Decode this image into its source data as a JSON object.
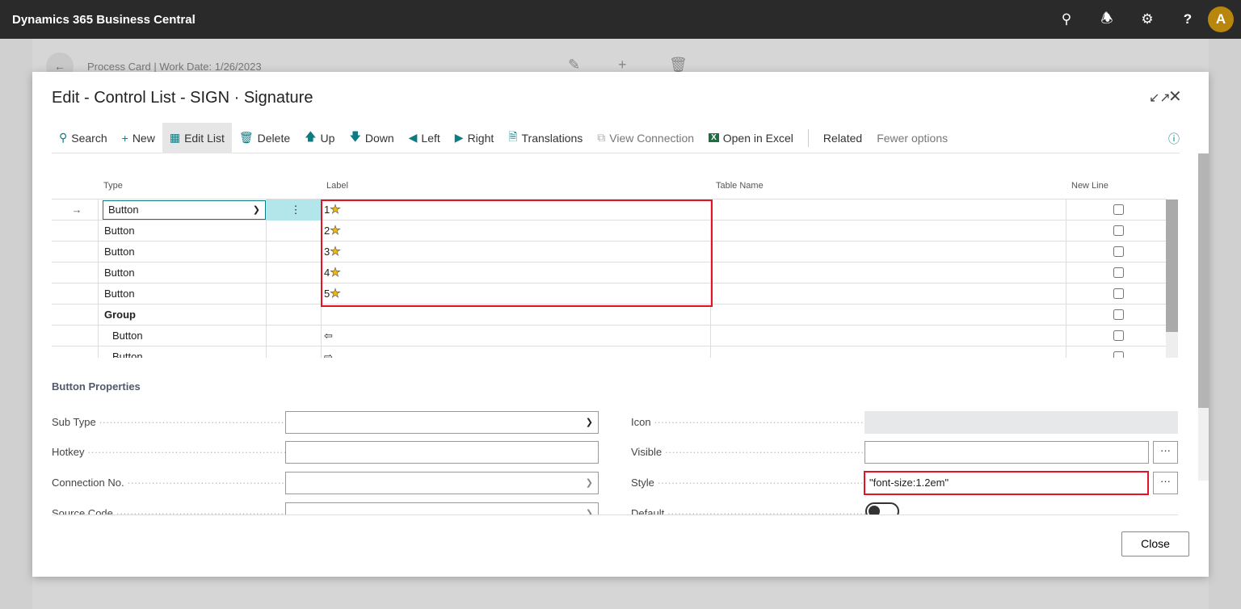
{
  "app": {
    "title": "Dynamics 365 Business Central",
    "avatar": "A",
    "icons": [
      "search-icon",
      "bell-icon",
      "gear-icon",
      "help-icon"
    ]
  },
  "background_page": {
    "header": "Process Card | Work Date: 1/26/2023"
  },
  "dialog": {
    "title": "Edit - Control List - SIGN · Signature",
    "toolbar": [
      {
        "icon": "search-icon",
        "label": "Search"
      },
      {
        "icon": "plus-icon",
        "label": "New"
      },
      {
        "icon": "edit-list-icon",
        "label": "Edit List",
        "active": true
      },
      {
        "icon": "delete-icon",
        "label": "Delete"
      },
      {
        "icon": "arrow-up-icon",
        "label": "Up"
      },
      {
        "icon": "arrow-down-icon",
        "label": "Down"
      },
      {
        "icon": "triangle-left-icon",
        "label": "Left"
      },
      {
        "icon": "triangle-right-icon",
        "label": "Right"
      },
      {
        "icon": "translations-icon",
        "label": "Translations"
      },
      {
        "icon": "view-connection-icon",
        "label": "View Connection",
        "disabled": true
      },
      {
        "icon": "excel-icon",
        "label": "Open in Excel"
      },
      {
        "label": "Related"
      },
      {
        "label": "Fewer options",
        "muted": true
      }
    ],
    "grid": {
      "columns": [
        "Type",
        "Label",
        "Table Name",
        "New Line"
      ],
      "rows": [
        {
          "type": "Button",
          "label": "1",
          "star": true,
          "selected": true
        },
        {
          "type": "Button",
          "label": "2",
          "star": true
        },
        {
          "type": "Button",
          "label": "3",
          "star": true
        },
        {
          "type": "Button",
          "label": "4",
          "star": true
        },
        {
          "type": "Button",
          "label": "5",
          "star": true
        },
        {
          "type": "Group",
          "label": "",
          "bold": true
        },
        {
          "type": "Button",
          "label": "⇦",
          "indent": true
        },
        {
          "type": "Button",
          "label": "⇨",
          "indent": true
        }
      ]
    },
    "properties": {
      "heading": "Button Properties",
      "left": [
        {
          "label": "Sub Type",
          "value": "",
          "kind": "select"
        },
        {
          "label": "Hotkey",
          "value": ""
        },
        {
          "label": "Connection No.",
          "value": "",
          "kind": "lookup"
        },
        {
          "label": "Source Code",
          "value": "",
          "kind": "lookup"
        }
      ],
      "right": [
        {
          "label": "Icon",
          "value": "",
          "readonly": true
        },
        {
          "label": "Visible",
          "value": "",
          "assist": true
        },
        {
          "label": "Style",
          "value": "\"font-size:1.2em\"",
          "assist": true
        },
        {
          "label": "Default",
          "toggle": false
        }
      ]
    },
    "close_label": "Close",
    "highlight_color": "#e81123",
    "accent_color": "#0d7b82"
  }
}
